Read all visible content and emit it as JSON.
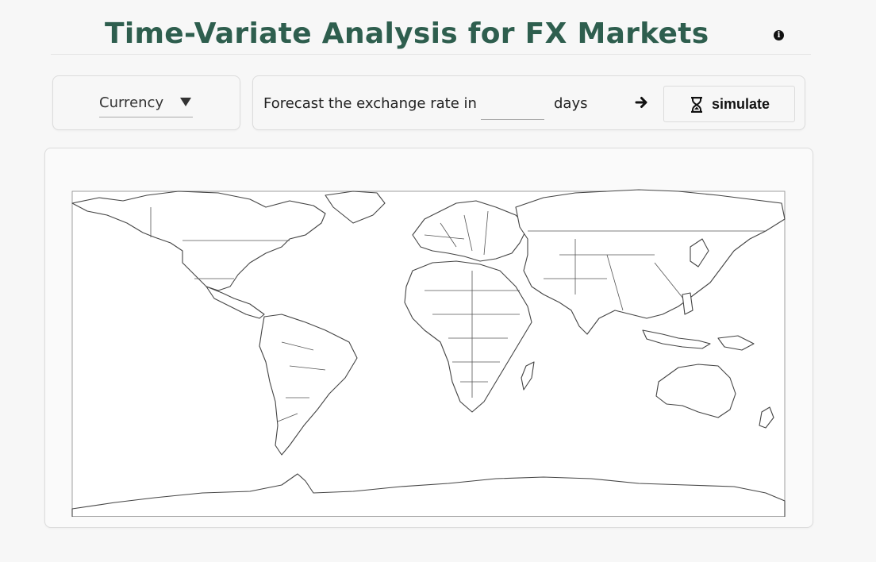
{
  "header": {
    "title": "Time-Variate Analysis for FX Markets",
    "info_icon": "info-circle-icon"
  },
  "controls": {
    "currency_select": {
      "selected": "Currency",
      "icon": "caret-down-icon"
    },
    "forecast": {
      "prefix": "Forecast the exchange rate in",
      "days_value": "",
      "days_placeholder": "",
      "suffix": "days",
      "arrow_icon": "arrow-right-icon"
    },
    "simulate_button": {
      "label": "simulate",
      "icon": "hourglass-icon"
    }
  },
  "map": {
    "type": "world-choropleth",
    "fill_color": "#ffffff",
    "stroke_color": "#444444"
  },
  "colors": {
    "title": "#2e5e4e",
    "background": "#f7f7f7"
  }
}
